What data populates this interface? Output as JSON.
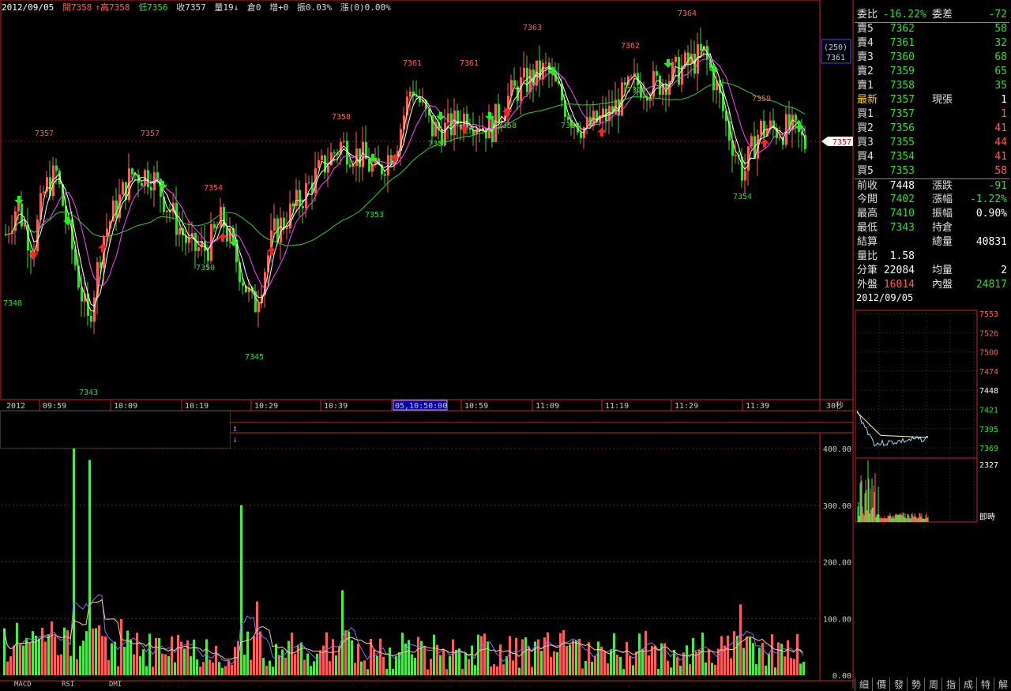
{
  "header": {
    "date": "2012/09/05",
    "open": "開7358",
    "high": "↑高7358",
    "low": "低7356",
    "close": "收7357",
    "vol": "量19↓",
    "oi": "倉0",
    "incr": "增+0",
    "amp": "振0.03%",
    "chg": "漲(0)0.00%"
  },
  "price_box": {
    "count": "(250)",
    "price": "7361"
  },
  "current_marker": "7357",
  "time_axis": {
    "start_label": "2012",
    "labels": [
      "09:59",
      "10:09",
      "10:19",
      "10:29",
      "10:39",
      "05,10:50:00",
      "10:59",
      "11:09",
      "11:19",
      "11:29",
      "11:39"
    ],
    "interval": "30秒"
  },
  "quote": {
    "top_left_label": "委比",
    "top_left_value": "-16.22%",
    "top_right_label": "委差",
    "top_right_value": "-72",
    "sells": [
      {
        "label": "賣5",
        "price": "7362",
        "qty": "58"
      },
      {
        "label": "賣4",
        "price": "7361",
        "qty": "32"
      },
      {
        "label": "賣3",
        "price": "7360",
        "qty": "68"
      },
      {
        "label": "賣2",
        "price": "7359",
        "qty": "65"
      },
      {
        "label": "賣1",
        "price": "7358",
        "qty": "35"
      }
    ],
    "last_label": "最新",
    "last_price": "7357",
    "now_label": "現張",
    "now_qty": "1",
    "buys": [
      {
        "label": "買1",
        "price": "7357",
        "qty": "1"
      },
      {
        "label": "買2",
        "price": "7356",
        "qty": "41"
      },
      {
        "label": "買3",
        "price": "7355",
        "qty": "44"
      },
      {
        "label": "買4",
        "price": "7354",
        "qty": "41"
      },
      {
        "label": "買5",
        "price": "7353",
        "qty": "58"
      }
    ],
    "prev_close_label": "前收",
    "prev_close": "7448",
    "chg_label": "漲跌",
    "chg": "-91",
    "open_label": "今開",
    "open": "7402",
    "chg_pct_label": "漲幅",
    "chg_pct": "-1.22%",
    "high_label": "最高",
    "high": "7410",
    "amp_label": "振幅",
    "amp": "0.90%",
    "low_label": "最低",
    "low": "7343",
    "oi_label": "持倉",
    "oi": "",
    "settle_label": "結算",
    "settle": "",
    "total_label": "總量",
    "total": "40831",
    "ratio_label": "量比",
    "ratio": "1.58",
    "ticks_label": "分筆",
    "ticks": "22084",
    "avg_label": "均量",
    "avg": "2",
    "outer_label": "外盤",
    "outer": "16014",
    "inner_label": "內盤",
    "inner": "24817"
  },
  "mini_chart": {
    "date": "2012/09/05",
    "price_ticks": [
      "7553",
      "7526",
      "7500",
      "7474",
      "7448",
      "7421",
      "7395",
      "7369"
    ],
    "vol_tick": "2327",
    "mode": "即時"
  },
  "right_tabs": [
    "細",
    "價",
    "發",
    "勢",
    "周",
    "指",
    "成",
    "特",
    "解"
  ],
  "bottom_tabs": [
    "MACD",
    "RSI",
    "DMI"
  ],
  "volume_axis": [
    "400.00",
    "300.00",
    "200.00",
    "100.00",
    "0.00"
  ],
  "price_labels": [
    "7357",
    "7357",
    "7354",
    "7350",
    "7348",
    "7343",
    "7345",
    "7353",
    "7358",
    "7357",
    "7361",
    "7361",
    "7363",
    "7358",
    "7358",
    "7362",
    "7360",
    "7364",
    "7359",
    "7354"
  ],
  "colors": {
    "up": "#ff5c5c",
    "down": "#33dd33",
    "ma1": "#ffffff",
    "ma2": "#ff44ff",
    "ma3": "#33cc33",
    "grid": "#8b1a1a",
    "axis": "#cc2222"
  },
  "chart_data": {
    "type": "candlestick",
    "interval": "30秒",
    "price_range": [
      7340,
      7366
    ],
    "candles_summary": {
      "open": 7402,
      "high": 7410,
      "low": 7343,
      "last": 7357
    },
    "annotated_extremes": [
      {
        "time": "09:59",
        "price": 7357
      },
      {
        "time": "10:05",
        "price": 7343
      },
      {
        "time": "10:09",
        "price": 7357
      },
      {
        "time": "10:19",
        "price": 7350
      },
      {
        "time": "10:19",
        "price": 7354
      },
      {
        "time": "10:29",
        "price": 7345
      },
      {
        "time": "10:39",
        "price": 7353
      },
      {
        "time": "10:39",
        "price": 7358
      },
      {
        "time": "10:49",
        "price": 7361
      },
      {
        "time": "10:55",
        "price": 7361
      },
      {
        "time": "10:59",
        "price": 7357
      },
      {
        "time": "11:02",
        "price": 7363
      },
      {
        "time": "11:10",
        "price": 7358
      },
      {
        "time": "11:19",
        "price": 7362
      },
      {
        "time": "11:29",
        "price": 7364
      },
      {
        "time": "11:39",
        "price": 7354
      },
      {
        "time": "11:41",
        "price": 7359
      }
    ],
    "volume_ylim": [
      0,
      430
    ]
  }
}
